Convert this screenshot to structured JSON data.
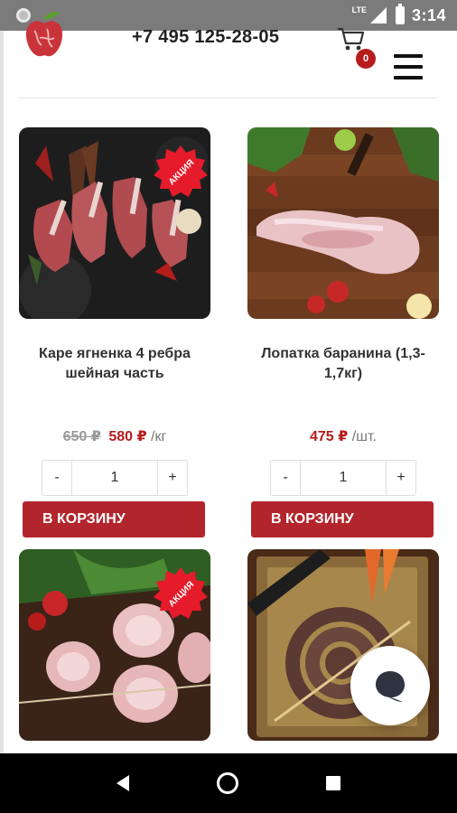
{
  "status_bar": {
    "network": "LTE",
    "time": "3:14"
  },
  "header": {
    "phone": "+7 495 125-28-05",
    "cart_count": "0"
  },
  "products": [
    {
      "name": "Каре ягненка 4 ребра шейная часть",
      "old_price": "650 ₽",
      "price": "580 ₽",
      "unit": "/кг",
      "qty": "1",
      "badge": "АКЦИЯ",
      "button": "В КОРЗИНУ"
    },
    {
      "name": "Лопатка баранина (1,3-1,7кг)",
      "old_price": "",
      "price": "475 ₽",
      "unit": "/шт.",
      "qty": "1",
      "badge": "",
      "button": "В КОРЗИНУ"
    },
    {
      "name": "",
      "badge": "АКЦИЯ"
    },
    {
      "name": "",
      "badge": ""
    }
  ],
  "qty_controls": {
    "minus": "-",
    "plus": "+"
  },
  "colors": {
    "accent": "#b3252c",
    "price": "#b71c1c"
  }
}
